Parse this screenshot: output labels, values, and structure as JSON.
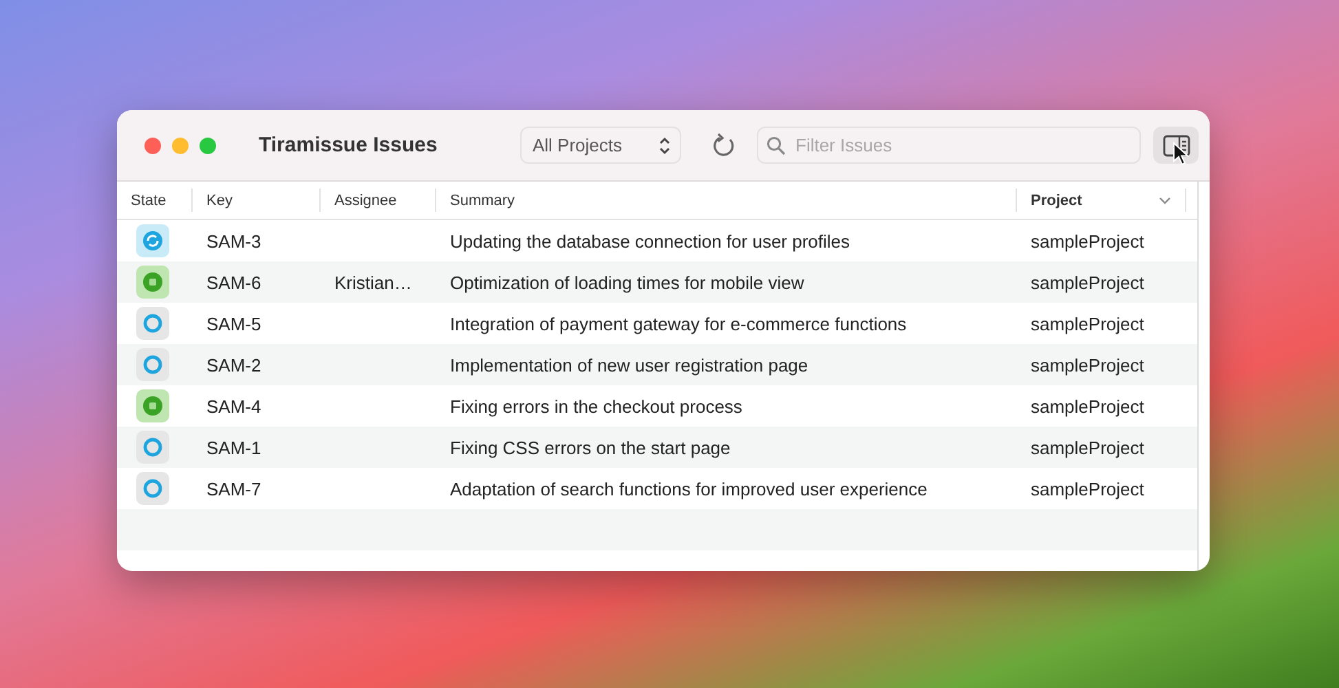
{
  "window": {
    "title": "Tiramissue Issues"
  },
  "toolbar": {
    "project_filter": "All Projects",
    "search": {
      "placeholder": "Filter Issues"
    },
    "inspector_toggle": {
      "hovered": true
    }
  },
  "table": {
    "columns": [
      {
        "label": "State",
        "sorted": false
      },
      {
        "label": "Key",
        "sorted": false
      },
      {
        "label": "Assignee",
        "sorted": false
      },
      {
        "label": "Summary",
        "sorted": false
      },
      {
        "label": "Project",
        "sorted": true
      }
    ],
    "rows": [
      {
        "kind": "in_progress",
        "key": "SAM-3",
        "summary": "Updating the database connection for user profiles",
        "project": "sampleProject"
      },
      {
        "kind": "done",
        "key": "SAM-6",
        "assignee": "Kristian…",
        "summary": "Optimization of loading times for mobile view",
        "project": "sampleProject"
      },
      {
        "kind": "open",
        "key": "SAM-5",
        "summary": "Integration of payment gateway for e-commerce functions",
        "project": "sampleProject"
      },
      {
        "kind": "open",
        "key": "SAM-2",
        "summary": "Implementation of new user registration page",
        "project": "sampleProject"
      },
      {
        "kind": "done",
        "key": "SAM-4",
        "summary": "Fixing errors in the checkout process",
        "project": "sampleProject"
      },
      {
        "kind": "open",
        "key": "SAM-1",
        "summary": "Fixing CSS errors on the start page",
        "project": "sampleProject"
      },
      {
        "kind": "open",
        "key": "SAM-7",
        "summary": "Adaptation of search functions for improved user experience",
        "project": "sampleProject"
      }
    ]
  }
}
